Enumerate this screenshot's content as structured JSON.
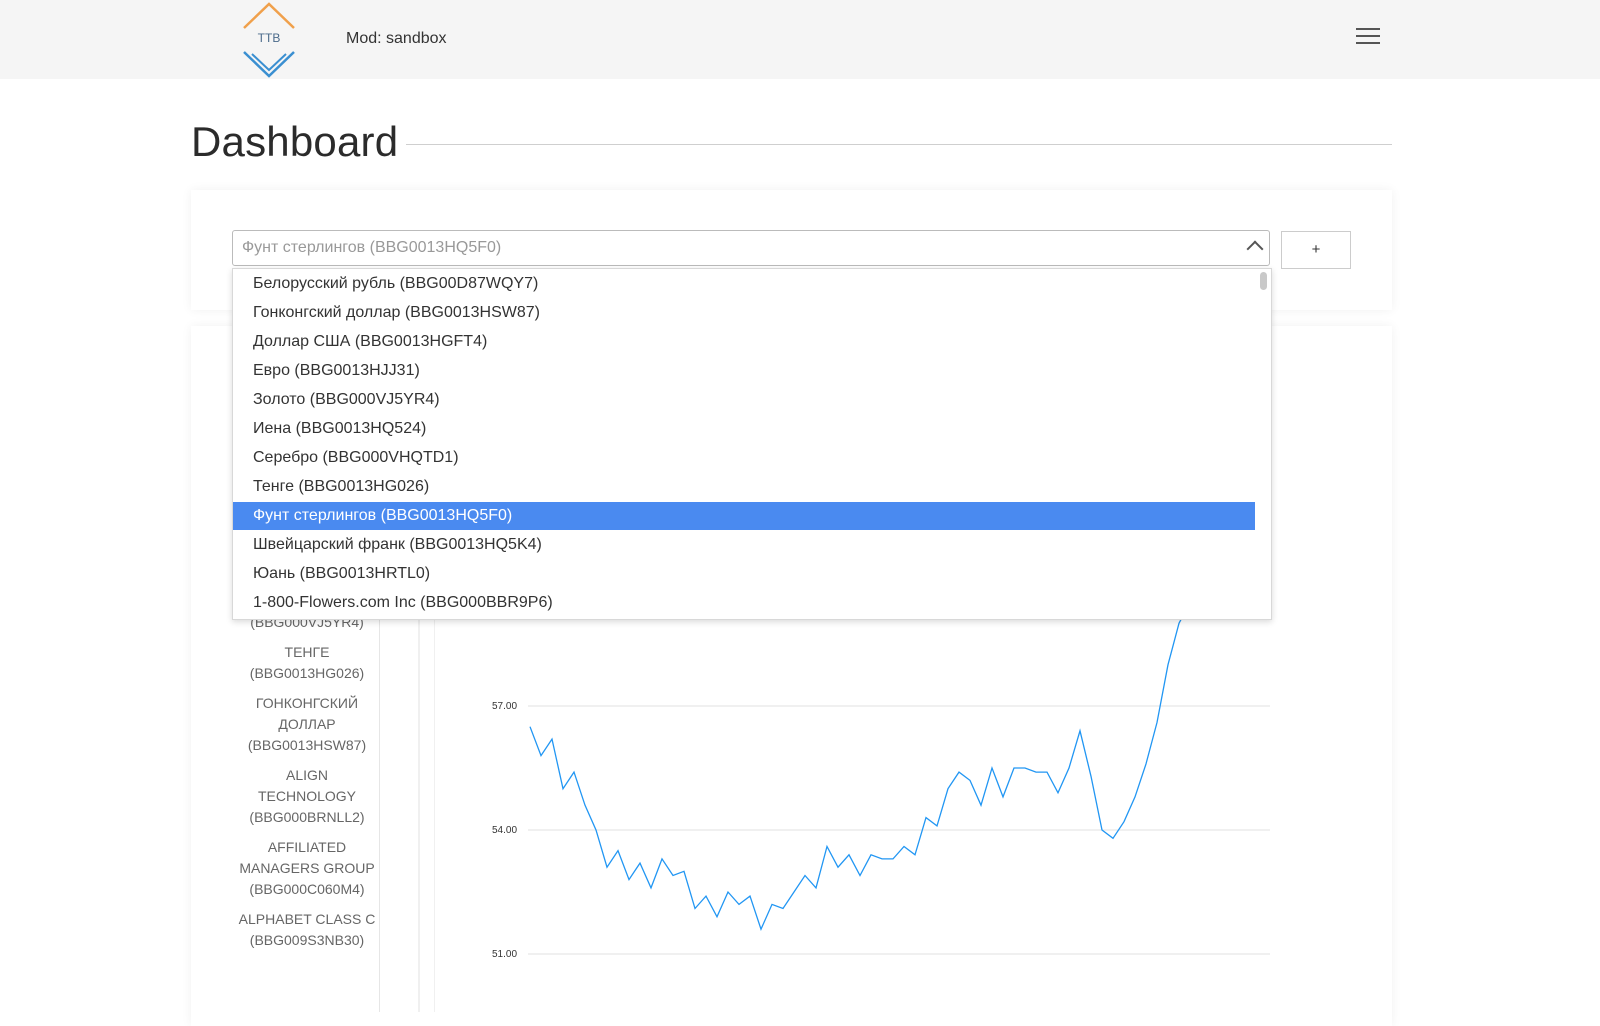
{
  "header": {
    "logo_text": "TTB",
    "mode_label": "Mod: sandbox"
  },
  "page": {
    "title": "Dashboard"
  },
  "select": {
    "value": "Фунт стерлингов (BBG0013HQ5F0)",
    "add_label": "+",
    "options": [
      "Белорусский рубль (BBG00D87WQY7)",
      "Гонконгский доллар (BBG0013HSW87)",
      "Доллар США (BBG0013HGFT4)",
      "Евро (BBG0013HJJ31)",
      "Золото (BBG000VJ5YR4)",
      "Иена (BBG0013HQ524)",
      "Серебро (BBG000VHQTD1)",
      "Тенге (BBG0013HG026)",
      "Фунт стерлингов (BBG0013HQ5F0)",
      "Швейцарский франк (BBG0013HQ5K4)",
      "Юань (BBG0013HRTL0)",
      "1-800-Flowers.com Inc (BBG000BBR9P6)"
    ],
    "selected_index": 8
  },
  "left_list": [
    "(BBG000VJ5YR4)",
    "ТЕНГЕ (BBG0013HG026)",
    "ГОНКОНГСКИЙ ДОЛЛАР (BBG0013HSW87)",
    "ALIGN TECHNOLOGY (BBG000BRNLL2)",
    "AFFILIATED MANAGERS GROUP (BBG000C060M4)",
    "ALPHABET CLASS C (BBG009S3NB30)"
  ],
  "colors": {
    "accent": "#4a8af0",
    "line": "#2196f3"
  },
  "chart_data": {
    "type": "line",
    "ytick_labels": [
      "57.00",
      "54.00",
      "51.00"
    ],
    "ylim": [
      51,
      59.5
    ],
    "grid": true,
    "series": [
      {
        "values": [
          56.5,
          55.8,
          56.2,
          55.0,
          55.4,
          54.6,
          54.0,
          53.1,
          53.5,
          52.8,
          53.2,
          52.6,
          53.3,
          52.9,
          53.0,
          52.1,
          52.4,
          51.9,
          52.5,
          52.2,
          52.4,
          51.6,
          52.2,
          52.1,
          52.5,
          52.9,
          52.6,
          53.6,
          53.1,
          53.4,
          52.9,
          53.4,
          53.3,
          53.3,
          53.6,
          53.4,
          54.3,
          54.1,
          55.0,
          55.4,
          55.2,
          54.6,
          55.5,
          54.8,
          55.5,
          55.5,
          55.4,
          55.4,
          54.9,
          55.5,
          56.4,
          55.3,
          54.0,
          53.8,
          54.2,
          54.8,
          55.6,
          56.6,
          58.0,
          59.0,
          59.5,
          59.6
        ]
      }
    ]
  }
}
